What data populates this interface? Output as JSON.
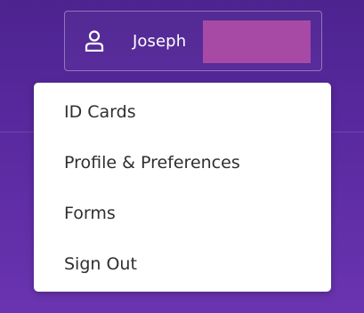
{
  "account": {
    "user_name": "Joseph",
    "icon": "user-icon"
  },
  "colors": {
    "background_top": "#4d2390",
    "background_bottom": "#6a34b0",
    "redaction": "#a64aa6",
    "menu_text": "#2f2f2f"
  },
  "menu": {
    "items": [
      {
        "label": "ID Cards"
      },
      {
        "label": "Profile & Preferences"
      },
      {
        "label": "Forms"
      },
      {
        "label": "Sign Out"
      }
    ]
  }
}
